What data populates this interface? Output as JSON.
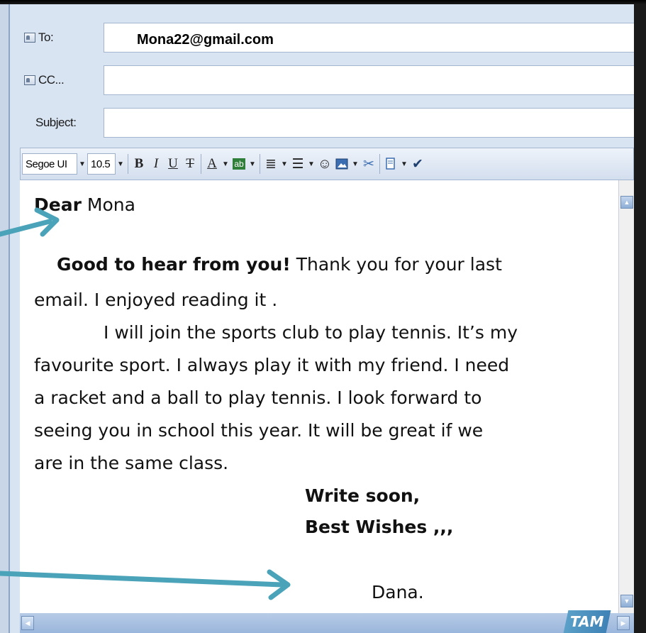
{
  "header": {
    "to_label": "To:",
    "to_value": "Mona22@gmail.com",
    "cc_label": "CC...",
    "cc_value": "",
    "subject_label": "Subject:",
    "subject_value": ""
  },
  "toolbar": {
    "font_name": "Segoe UI",
    "font_size": "10.5",
    "bold": "B",
    "italic": "I",
    "underline": "U",
    "strike": "T",
    "font_color": "A",
    "highlight": "ab",
    "icons": [
      "bold-icon",
      "italic-icon",
      "underline-icon",
      "strikethrough-icon",
      "font-color-icon",
      "highlight-icon",
      "align-icon",
      "list-icon",
      "emoticon-icon",
      "image-icon",
      "scissors-icon",
      "stationery-icon",
      "spell-check-icon"
    ]
  },
  "body": {
    "greeting_bold": "Dear",
    "greeting_name": " Mona",
    "line1_bold": "Good to hear from you!",
    "line1_rest": " Thank you for your last",
    "line2": "email. I enjoyed reading it .",
    "line3": "I will join the sports club to play tennis. It’s my",
    "line4": "favourite sport. I always play it with my friend. I need",
    "line5": "a racket and a ball to play tennis. I look forward to",
    "line6": "seeing you in school this year. It will be great if we",
    "line7": "are in the same class.",
    "closing1": "Write soon,",
    "closing2": "Best Wishes ,,,",
    "signature": "Dana."
  },
  "logo_text": "TAM",
  "colors": {
    "accent_arrow": "#4aa3b8",
    "window_bg": "#d9e4f3"
  }
}
